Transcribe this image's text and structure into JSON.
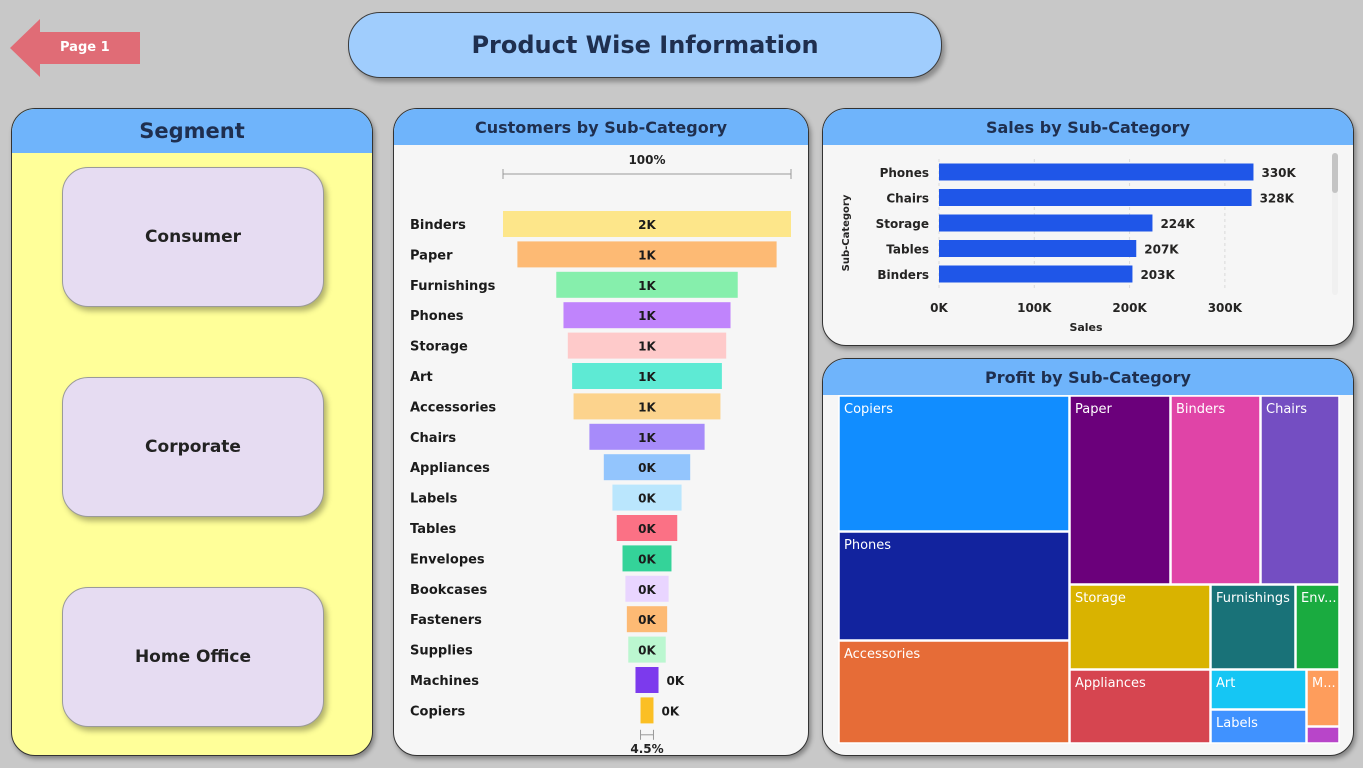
{
  "nav": {
    "back_label": "Page 1"
  },
  "header": {
    "title": "Product Wise Information"
  },
  "segment": {
    "title": "Segment",
    "items": [
      "Consumer",
      "Corporate",
      "Home Office"
    ]
  },
  "customers": {
    "title": "Customers by Sub-Category",
    "top_pct": "100%",
    "bottom_pct": "4.5%"
  },
  "sales": {
    "title": "Sales by Sub-Category",
    "ylabel": "Sub-Category",
    "xlabel": "Sales"
  },
  "profit": {
    "title": "Profit by Sub-Category"
  },
  "chart_data": [
    {
      "type": "funnel",
      "title": "Customers by Sub-Category",
      "categories": [
        "Binders",
        "Paper",
        "Furnishings",
        "Phones",
        "Storage",
        "Art",
        "Accessories",
        "Chairs",
        "Appliances",
        "Labels",
        "Tables",
        "Envelopes",
        "Bookcases",
        "Fasteners",
        "Supplies",
        "Machines",
        "Copiers"
      ],
      "values": [
        1.0,
        0.9,
        0.63,
        0.58,
        0.55,
        0.52,
        0.51,
        0.4,
        0.3,
        0.24,
        0.21,
        0.17,
        0.15,
        0.14,
        0.13,
        0.08,
        0.045
      ],
      "value_labels": [
        "2K",
        "1K",
        "1K",
        "1K",
        "1K",
        "1K",
        "1K",
        "1K",
        "0K",
        "0K",
        "0K",
        "0K",
        "0K",
        "0K",
        "0K",
        "0K",
        "0K"
      ],
      "colors": [
        "#fde68a",
        "#fdba74",
        "#86efac",
        "#c084fc",
        "#fecaca",
        "#5eead4",
        "#fcd38d",
        "#a78bfa",
        "#93c5fd",
        "#bae6fd",
        "#fb7185",
        "#34d399",
        "#e9d5ff",
        "#fdba74",
        "#bbf7d0",
        "#7c3aed",
        "#fbbf24"
      ],
      "top_label": "100%",
      "bottom_label": "4.5%"
    },
    {
      "type": "bar",
      "orientation": "horizontal",
      "title": "Sales by Sub-Category",
      "categories": [
        "Phones",
        "Chairs",
        "Storage",
        "Tables",
        "Binders"
      ],
      "values": [
        330000,
        328000,
        224000,
        207000,
        203000
      ],
      "value_labels": [
        "330K",
        "328K",
        "224K",
        "207K",
        "203K"
      ],
      "xlabel": "Sales",
      "ylabel": "Sub-Category",
      "xticks": [
        "0K",
        "100K",
        "200K",
        "300K"
      ],
      "xlim": [
        0,
        340000
      ],
      "color": "#1f56e8",
      "grid": true
    },
    {
      "type": "treemap",
      "title": "Profit by Sub-Category",
      "items": [
        {
          "name": "Copiers",
          "label": "Copiers",
          "color": "#118dff"
        },
        {
          "name": "Phones",
          "label": "Phones",
          "color": "#12239e"
        },
        {
          "name": "Accessories",
          "label": "Accessories",
          "color": "#e66c37"
        },
        {
          "name": "Paper",
          "label": "Paper",
          "color": "#6b007b"
        },
        {
          "name": "Binders",
          "label": "Binders",
          "color": "#e044a7"
        },
        {
          "name": "Chairs",
          "label": "Chairs",
          "color": "#744ec2"
        },
        {
          "name": "Storage",
          "label": "Storage",
          "color": "#d9b300"
        },
        {
          "name": "Furnishings",
          "label": "Furnishings",
          "color": "#197278"
        },
        {
          "name": "Envelopes",
          "label": "Env...",
          "color": "#1aab40"
        },
        {
          "name": "Appliances",
          "label": "Appliances",
          "color": "#d64550"
        },
        {
          "name": "Art",
          "label": "Art",
          "color": "#15c6f4"
        },
        {
          "name": "Machines",
          "label": "M...",
          "color": "#fe9d5c"
        },
        {
          "name": "Labels",
          "label": "Labels",
          "color": "#4092ff"
        },
        {
          "name": "Other",
          "label": "",
          "color": "#b845c9"
        }
      ]
    }
  ]
}
